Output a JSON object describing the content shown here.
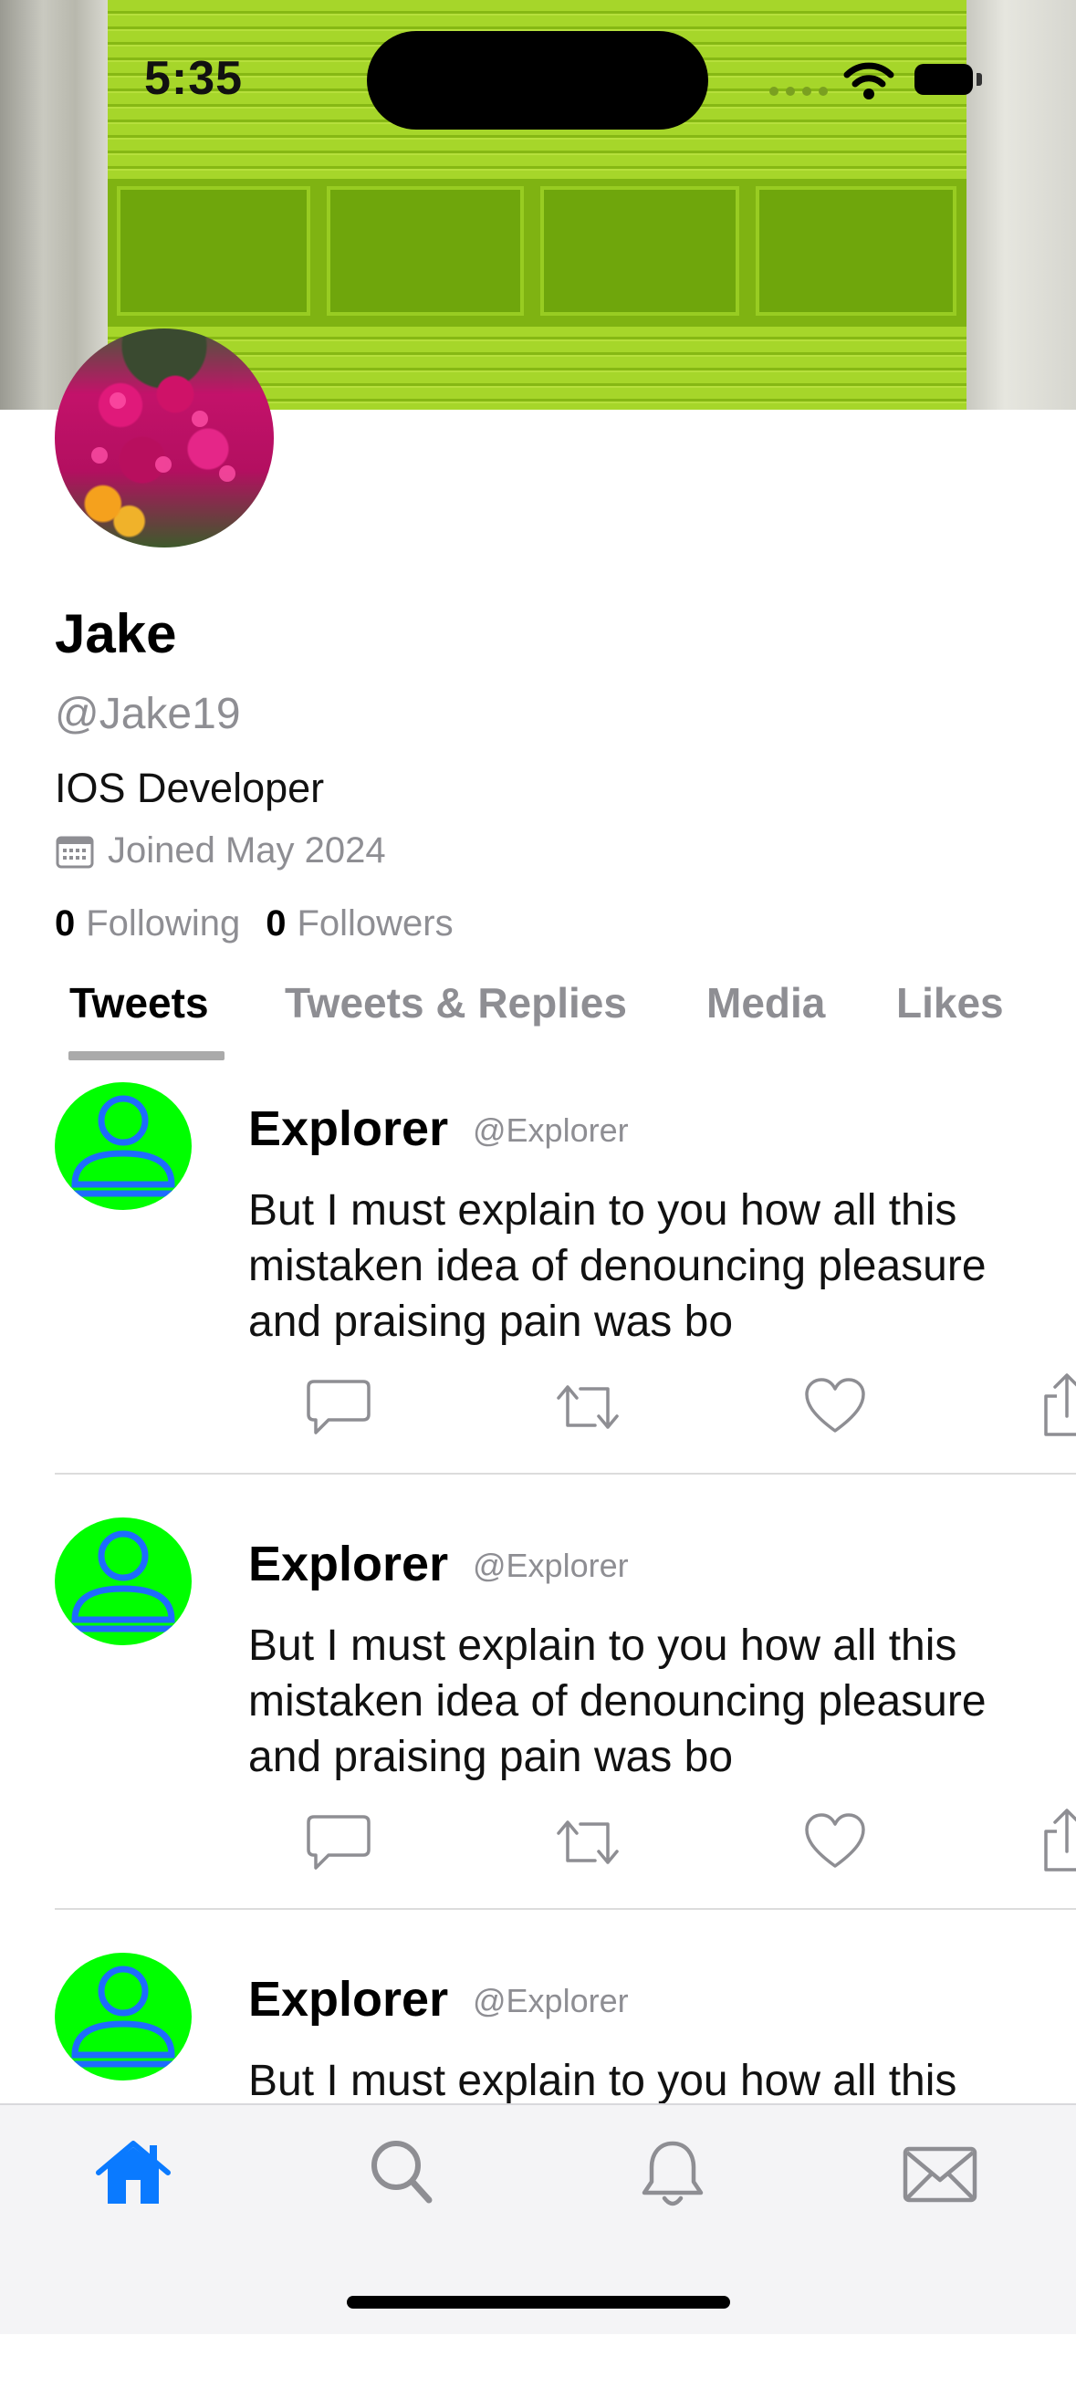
{
  "status_bar": {
    "time": "5:35"
  },
  "profile": {
    "name": "Jake",
    "handle": "@Jake19",
    "bio": "IOS Developer",
    "joined": "Joined May 2024",
    "following_count": "0",
    "following_label": "Following",
    "followers_count": "0",
    "followers_label": "Followers"
  },
  "tabs": [
    {
      "label": "Tweets",
      "active": true
    },
    {
      "label": "Tweets & Replies",
      "active": false
    },
    {
      "label": "Media",
      "active": false
    },
    {
      "label": "Likes",
      "active": false
    }
  ],
  "tweets": [
    {
      "name": "Explorer",
      "handle": "@Explorer",
      "text": "But I must explain to you how all this mistaken idea of denouncing pleasure and praising pain was bo"
    },
    {
      "name": "Explorer",
      "handle": "@Explorer",
      "text": "But I must explain to you how all this mistaken idea of denouncing pleasure and praising pain was bo"
    },
    {
      "name": "Explorer",
      "handle": "@Explorer",
      "text": "But I must explain to you how all this mistaken idea of denouncing pleasure and praising pain was bo"
    }
  ],
  "tab_bar": {
    "items": [
      {
        "icon": "house-icon",
        "active": true
      },
      {
        "icon": "search-icon",
        "active": false
      },
      {
        "icon": "bell-icon",
        "active": false
      },
      {
        "icon": "envelope-icon",
        "active": false
      }
    ]
  },
  "colors": {
    "accent": "#0a7aff",
    "avatar_bg": "#00ff00",
    "avatar_figure": "#1e6bff",
    "muted_text": "#8e8e93"
  }
}
